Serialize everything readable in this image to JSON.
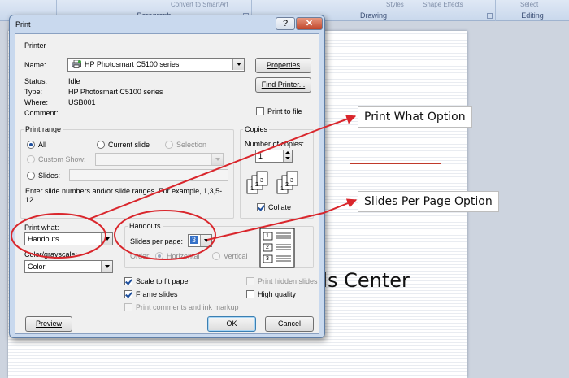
{
  "ribbon": {
    "paragraph_label": "Paragraph",
    "drawing_label": "Drawing",
    "editing_label": "Editing",
    "convert_text": "Convert to SmartArt",
    "styles_text": "Styles",
    "shape_effects_text": "Shape Effects",
    "select_text": "Select"
  },
  "slide": {
    "title_text": "ills Center"
  },
  "callouts": {
    "print_what": "Print What Option",
    "slides_per_page": "Slides Per Page Option"
  },
  "dialog": {
    "title": "Print",
    "help_glyph": "?",
    "close_glyph": "✕",
    "printer": {
      "group_label": "Printer",
      "name_label": "Name:",
      "name_value": "HP Photosmart C5100 series",
      "status_label": "Status:",
      "status_value": "Idle",
      "type_label": "Type:",
      "type_value": "HP Photosmart C5100 series",
      "where_label": "Where:",
      "where_value": "USB001",
      "comment_label": "Comment:",
      "properties_button": "Properties",
      "find_printer_button": "Find Printer...",
      "print_to_file_label": "Print to file",
      "print_to_file_checked": false
    },
    "print_range": {
      "group_label": "Print range",
      "all_label": "All",
      "all_checked": true,
      "current_slide_label": "Current slide",
      "selection_label": "Selection",
      "custom_show_label": "Custom Show:",
      "slides_label": "Slides:",
      "hint": "Enter slide numbers and/or slide ranges. For example, 1,3,5-12"
    },
    "copies": {
      "group_label": "Copies",
      "number_label": "Number of copies:",
      "number_value": "1",
      "collate_label": "Collate",
      "collate_checked": true,
      "page_numbers": [
        "1",
        "2",
        "3"
      ]
    },
    "print_what": {
      "label": "Print what:",
      "value": "Handouts"
    },
    "color": {
      "label": "Color/grayscale:",
      "value": "Color"
    },
    "handouts": {
      "group_label": "Handouts",
      "slides_per_page_label": "Slides per page:",
      "slides_per_page_value": "3",
      "order_label": "Order:",
      "horizontal_label": "Horizontal",
      "vertical_label": "Vertical",
      "preview_numbers": [
        "1",
        "2",
        "3"
      ]
    },
    "options": {
      "scale_to_fit_label": "Scale to fit paper",
      "scale_to_fit_checked": true,
      "frame_slides_label": "Frame slides",
      "frame_slides_checked": true,
      "comments_label": "Print comments and ink markup",
      "print_hidden_label": "Print hidden slides",
      "high_quality_label": "High quality",
      "high_quality_checked": false
    },
    "buttons": {
      "preview": "Preview",
      "ok": "OK",
      "cancel": "Cancel"
    }
  },
  "colors": {
    "annotation_red": "#d9262c",
    "dialog_frame": "#c9d9ee",
    "accent_blue": "#1e4f9c"
  }
}
